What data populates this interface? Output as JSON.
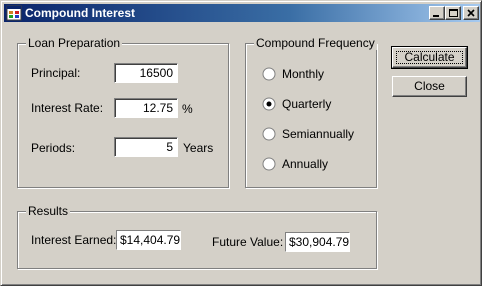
{
  "window": {
    "title": "Compound Interest",
    "minimize_glyph": "_",
    "maximize_glyph": "□",
    "close_glyph": "×"
  },
  "loan": {
    "group_label": "Loan Preparation",
    "principal_label": "Principal:",
    "principal_value": "16500",
    "rate_label": "Interest Rate:",
    "rate_value": "12.75",
    "rate_unit": "%",
    "periods_label": "Periods:",
    "periods_value": "5",
    "periods_unit": "Years"
  },
  "frequency": {
    "group_label": "Compound Frequency",
    "options": [
      {
        "label": "Monthly",
        "selected": false
      },
      {
        "label": "Quarterly",
        "selected": true
      },
      {
        "label": "Semiannually",
        "selected": false
      },
      {
        "label": "Annually",
        "selected": false
      }
    ]
  },
  "buttons": {
    "calculate": "Calculate",
    "close": "Close"
  },
  "results": {
    "group_label": "Results",
    "interest_label": "Interest Earned:",
    "interest_value": "$14,404.79",
    "future_label": "Future Value:",
    "future_value": "$30,904.79"
  },
  "icons": {
    "app": "app-icon",
    "radio_selected": "radio-selected-icon",
    "radio_unselected": "radio-unselected-icon"
  }
}
